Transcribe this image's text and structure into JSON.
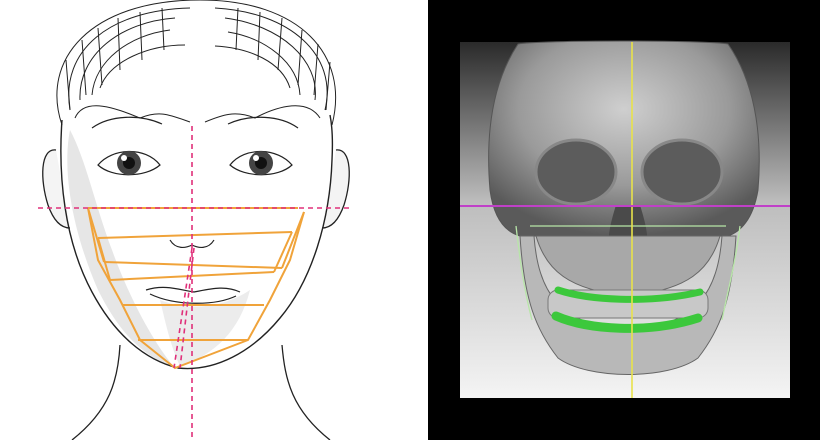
{
  "figure": {
    "left_panel": {
      "name": "face-line-drawing",
      "guide_color": "#e0307a",
      "grid_color": "#f0a33a",
      "skin_shadow_color": "#e6e6e6",
      "outline_color": "#222222"
    },
    "right_panel": {
      "name": "ct-skull-reconstruction",
      "background": "#000000",
      "vertical_axis_color": "#e8e24a",
      "horizontal_axis_color": "#c040c8",
      "occlusal_highlight_color": "#3cc83c",
      "jaw_trace_color": "#b8e6a8"
    }
  }
}
